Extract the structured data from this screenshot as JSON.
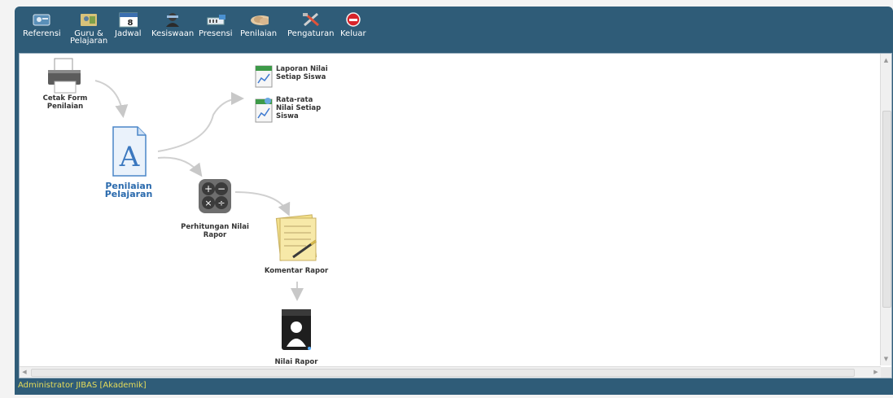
{
  "toolbar": {
    "items": [
      {
        "label": "Referensi",
        "icon": "referensi-icon"
      },
      {
        "label": "Guru & Pelajaran",
        "icon": "guru-pelajaran-icon"
      },
      {
        "label": "Jadwal",
        "icon": "calendar-icon"
      },
      {
        "label": "Kesiswaan",
        "icon": "student-icon"
      },
      {
        "label": "Presensi",
        "icon": "presensi-icon"
      },
      {
        "label": "Penilaian",
        "icon": "handshake-icon"
      },
      {
        "label": "Pengaturan",
        "icon": "tools-icon"
      },
      {
        "label": "Keluar",
        "icon": "exit-icon"
      }
    ]
  },
  "calendar_day": "8",
  "flow": {
    "cetak_form": "Cetak Form Penilaian",
    "laporan_nilai": "Laporan Nilai Setiap Siswa",
    "rata_rata": "Rata-rata Nilai Setiap Siswa",
    "penilaian_pelajaran": "Penilaian Pelajaran",
    "perhitungan": "Perhitungan Nilai Rapor",
    "komentar": "Komentar Rapor",
    "nilai_rapor": "Nilai Rapor"
  },
  "status_bar": "Administrator JIBAS [Akademik]",
  "colors": {
    "frame": "#2f5c78",
    "status_text": "#e6dc5a",
    "highlight_label": "#2a6aad"
  }
}
